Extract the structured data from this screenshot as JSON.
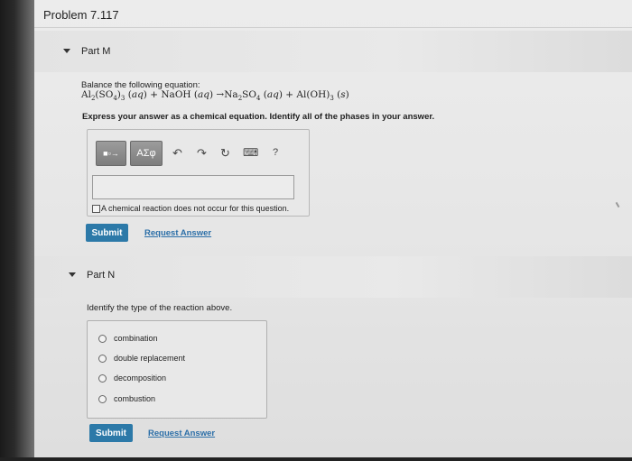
{
  "problem": {
    "title": "Problem 7.117"
  },
  "part_m": {
    "label": "Part M",
    "intro": "Balance the following equation:",
    "equation_segments": {
      "s1": "Al",
      "sub1": "2",
      "s2": "(SO",
      "sub2": "4",
      "s3": ")",
      "sub3": "3",
      "s4": " (",
      "aq1": "aq",
      "s5": ") + NaOH (",
      "aq2": "aq",
      "s6": ") →Na",
      "sub4": "2",
      "s7": "SO",
      "sub5": "4",
      "s8": " (",
      "aq3": "aq",
      "s9": ") + Al(OH)",
      "sub6": "3",
      "s10": " (",
      "sol": "s",
      "s11": ")"
    },
    "instruction": "Express your answer as a chemical equation. Identify all of the phases in your answer.",
    "toolbar": {
      "templates_label": "■▫→",
      "greek_label": "AΣφ",
      "undo_glyph": "↶",
      "redo_glyph": "↷",
      "reset_glyph": "↻",
      "keyboard_glyph": "⌨",
      "help_glyph": "?"
    },
    "answer_value": "",
    "no_reaction_label": "A chemical reaction does not occur for this question.",
    "submit_label": "Submit",
    "request_label": "Request Answer"
  },
  "part_n": {
    "label": "Part N",
    "question": "Identify the type of the reaction above.",
    "options": [
      {
        "label": "combination"
      },
      {
        "label": "double replacement"
      },
      {
        "label": "decomposition"
      },
      {
        "label": "combustion"
      }
    ],
    "submit_label": "Submit",
    "request_label": "Request Answer"
  },
  "colors": {
    "submit_bg": "#2c79a8",
    "link": "#2c6fa8"
  }
}
